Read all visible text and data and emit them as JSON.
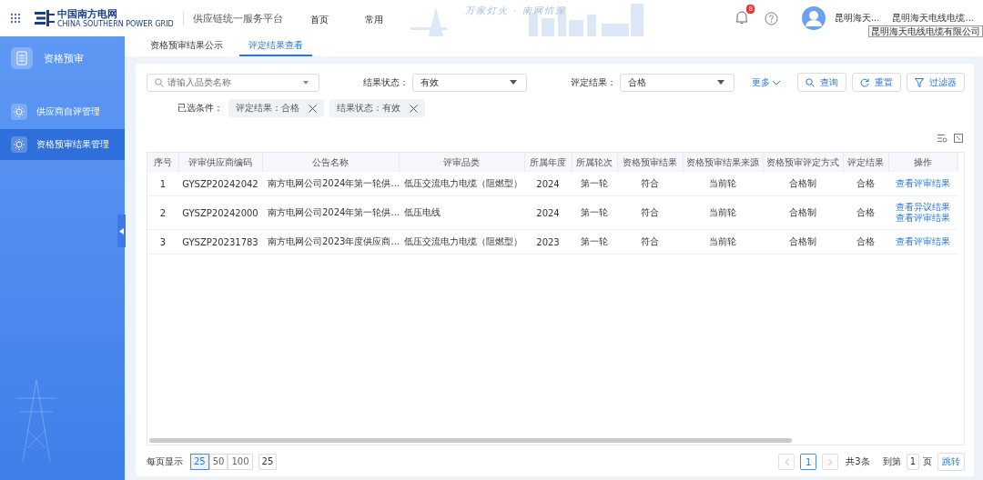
{
  "header": {
    "logo_text": "中国南方电网",
    "logo_subtext": "CHINA SOUTHERN POWER GRID",
    "platform_title": "供应链统一服务平台",
    "nav": [
      {
        "label": "首页"
      },
      {
        "label": "常用"
      }
    ],
    "slogan": "万家灯火 · 南网情深",
    "notification_count": "8",
    "user_name": "昆明海天...",
    "company": "昆明海天电线电缆...",
    "company_tooltip": "昆明海天电线电缆有限公司"
  },
  "sidebar": {
    "title": "资格预审",
    "items": [
      {
        "label": "供应商自评管理",
        "selected": false
      },
      {
        "label": "资格预审结果管理",
        "selected": true
      }
    ]
  },
  "tabs": [
    {
      "label": "资格预审结果公示",
      "selected": false
    },
    {
      "label": "评定结果查看",
      "selected": true
    }
  ],
  "filters": {
    "search": {
      "placeholder": "请输入品类名称"
    },
    "selects": [
      {
        "label": "结果状态：",
        "value": "有效"
      },
      {
        "label": "评定结果：",
        "value": "合格"
      }
    ],
    "more": "更多",
    "buttons": [
      {
        "kind": "search",
        "label": "查询"
      },
      {
        "kind": "reset",
        "label": "重置"
      },
      {
        "kind": "filter",
        "label": "过滤器"
      }
    ],
    "selected_label": "已选条件：",
    "tags": [
      "评定结果：合格",
      "结果状态：有效"
    ]
  },
  "table": {
    "columns": [
      "序号",
      "评审供应商编码",
      "公告名称",
      "评审品类",
      "所属年度",
      "所属轮次",
      "资格预审结果",
      "资格预审结果来源",
      "资格预审评定方式",
      "评定结果",
      "操作"
    ],
    "rows": [
      {
        "cells": [
          "1",
          "GYSZP20242042",
          "南方电网公司2024年第一轮供...",
          "低压交流电力电缆（阻燃型）",
          "2024",
          "第一轮",
          "符合",
          "当前轮",
          "合格制",
          "合格"
        ],
        "actions": [
          "查看评审结果"
        ]
      },
      {
        "cells": [
          "2",
          "GYSZP20242000",
          "南方电网公司2024年第一轮供...",
          "低压电线",
          "2024",
          "第一轮",
          "符合",
          "当前轮",
          "合格制",
          "合格"
        ],
        "actions": [
          "查看异议结果",
          "查看评审结果"
        ]
      },
      {
        "cells": [
          "3",
          "GYSZP20231783",
          "南方电网公司2023年度供应商...",
          "低压交流电力电缆（阻燃型）",
          "2023",
          "第一轮",
          "符合",
          "当前轮",
          "合格制",
          "合格"
        ],
        "actions": [
          "查看评审结果"
        ]
      }
    ]
  },
  "pagination": {
    "per_page_label": "每页显示",
    "sizes": [
      {
        "label": "25",
        "selected": true
      },
      {
        "label": "50",
        "selected": false
      },
      {
        "label": "100",
        "selected": false
      }
    ],
    "size_input": "25",
    "pages": [
      {
        "label": "1",
        "selected": true
      }
    ],
    "total": "共3条",
    "goto_label": "到第",
    "goto_value": "1",
    "page_unit": "页",
    "jump": "跳转"
  }
}
